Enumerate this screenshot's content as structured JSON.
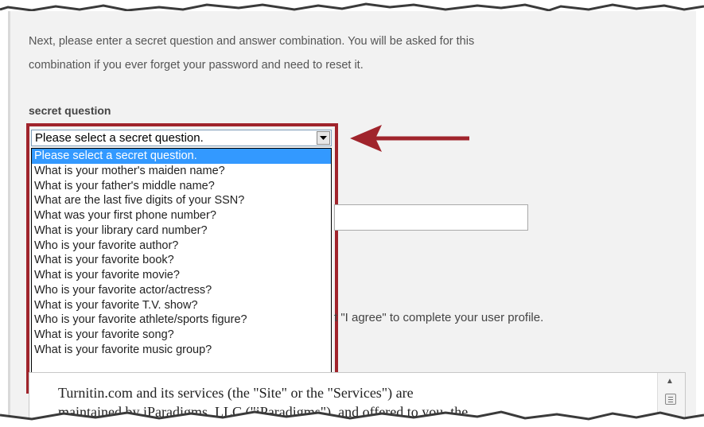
{
  "intro": {
    "line1": "Next, please enter a secret question and answer combination. You will be asked for this",
    "line2": "combination if you ever forget your password and need to reset it."
  },
  "secret_question": {
    "label": "secret question",
    "selected_value": "Please select a secret question.",
    "options": [
      "Please select a secret question.",
      "What is your mother's maiden name?",
      "What is your father's middle name?",
      "What are the last five digits of your SSN?",
      "What was your first phone number?",
      "What is your library card number?",
      "Who is your favorite author?",
      "What is your favorite book?",
      "What is your favorite movie?",
      "Who is your favorite actor/actress?",
      "What is your favorite T.V. show?",
      "Who is your favorite athlete/sports figure?",
      "What is your favorite song?",
      "What is your favorite music group?"
    ]
  },
  "agreement": {
    "partial_text": "t \"I agree\" to complete your user profile."
  },
  "terms": {
    "line1": "Turnitin.com and its services (the \"Site\" or the \"Services\") are",
    "line2": "maintained by iParadigms, LLC (\"iParadigms\"), and offered to you, the"
  },
  "colors": {
    "highlight": "#a0242c",
    "selected_option": "#3399ff",
    "panel_background": "#f2f2f2"
  },
  "icons": {
    "dropdown_arrow": "chevron-down-icon",
    "callout_arrow": "left-arrow-icon",
    "scroll_up": "scroll-up-icon",
    "scroll_grip": "scroll-grip-icon"
  }
}
